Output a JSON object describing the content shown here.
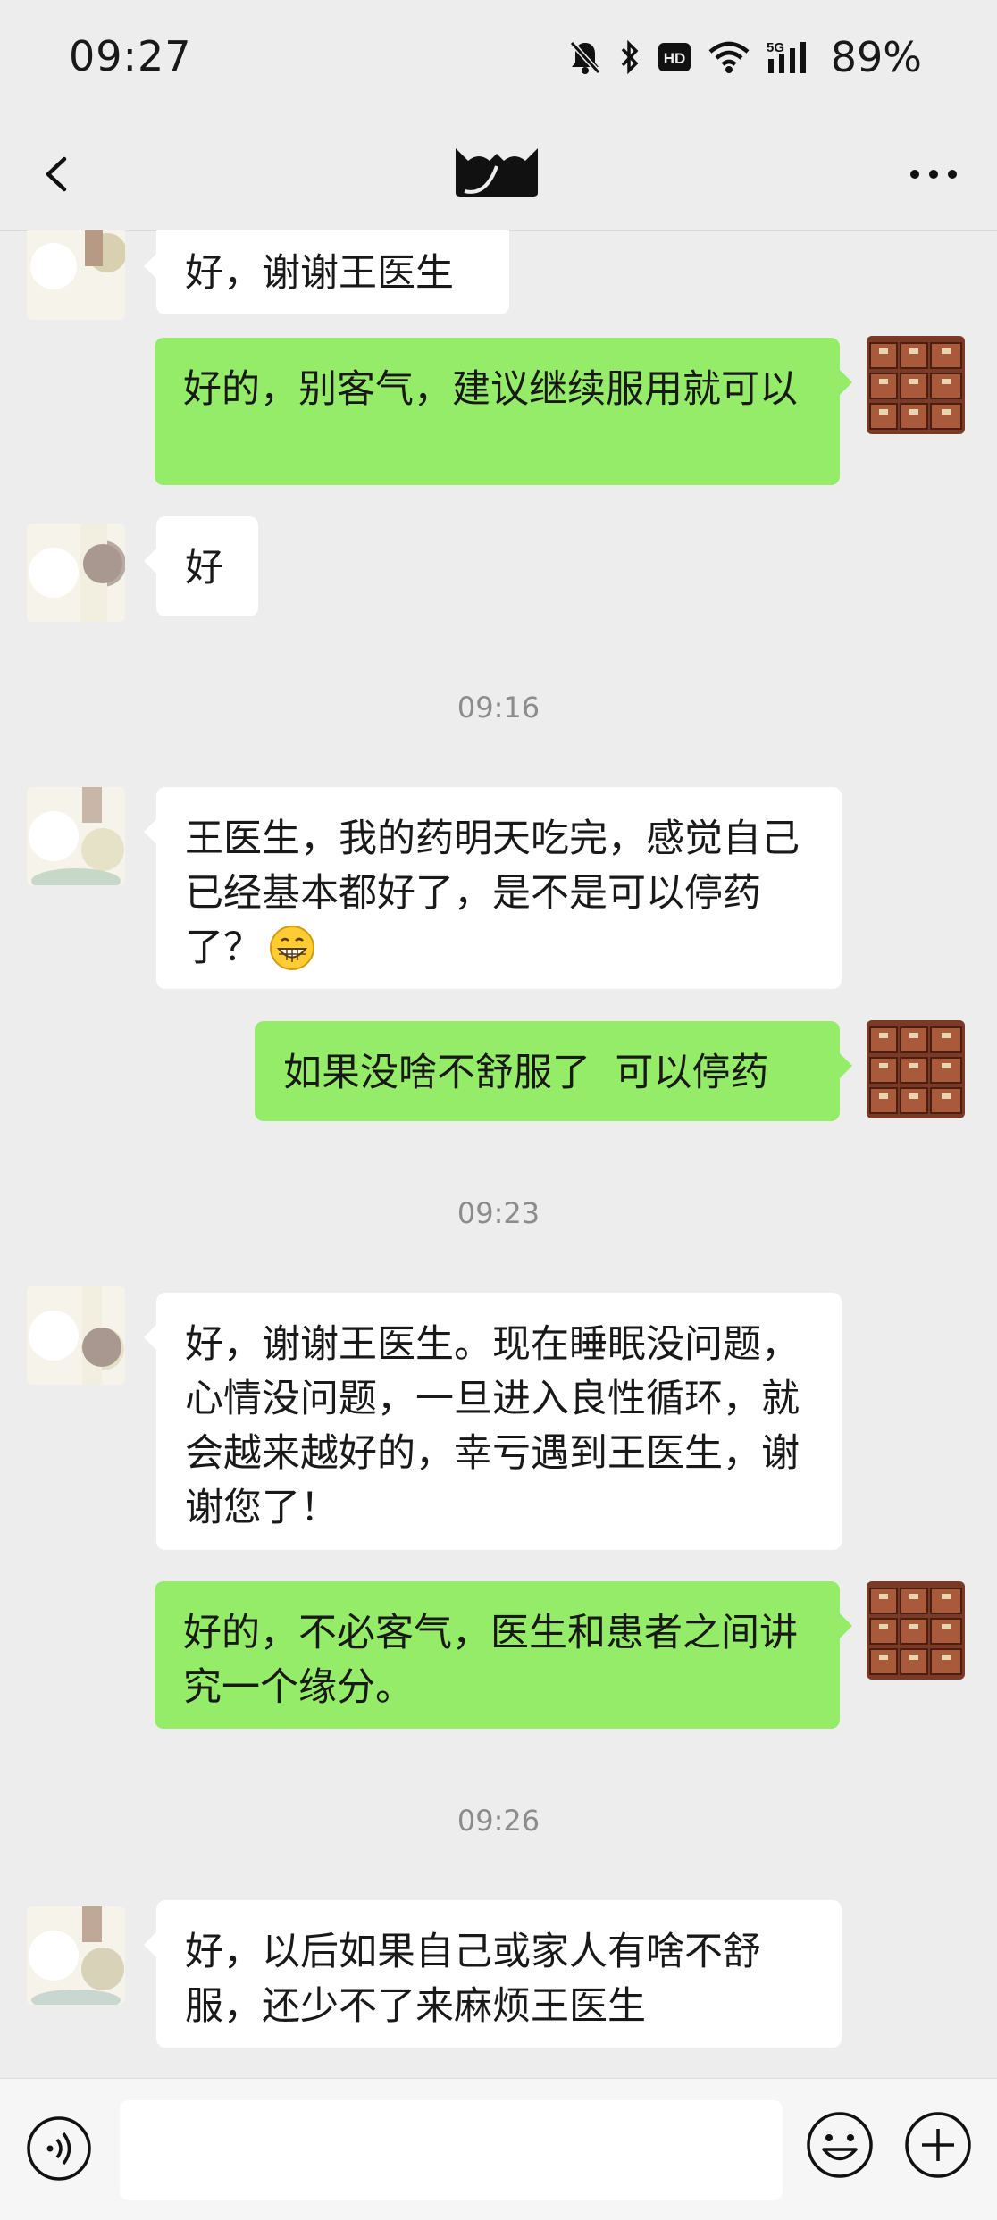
{
  "status_bar": {
    "time": "09:27",
    "icons": [
      "mute-bell-icon",
      "bluetooth-icon",
      "hd-icon",
      "wifi-icon",
      "5g-signal-icon"
    ],
    "battery": "89%"
  },
  "header": {
    "back_icon": "chevron-left-icon",
    "title_icon": "contact-logo-icon",
    "more_icon": "more-dots-icon"
  },
  "colors": {
    "background": "#ededed",
    "incoming_bubble": "#ffffff",
    "outgoing_bubble": "#95ec69",
    "timestamp_text": "#8c8c8c"
  },
  "messages": [
    {
      "side": "left",
      "text": "好，谢谢王医生"
    },
    {
      "side": "right",
      "text": "好的，别客气，建议继续服用就可以"
    },
    {
      "side": "left",
      "text": "好"
    },
    {
      "timestamp": "09:16"
    },
    {
      "side": "left",
      "text": "王医生，我的药明天吃完，感觉自己已经基本都好了，是不是可以停药了？",
      "emoji": "grinning-face-emoji"
    },
    {
      "side": "right",
      "text": "如果没啥不舒服了  可以停药"
    },
    {
      "timestamp": "09:23"
    },
    {
      "side": "left",
      "text": "好，谢谢王医生。现在睡眠没问题，心情没问题，一旦进入良性循环，就会越来越好的，幸亏遇到王医生，谢谢您了！"
    },
    {
      "side": "right",
      "text": "好的，不必客气，医生和患者之间讲究一个缘分。"
    },
    {
      "timestamp": "09:26"
    },
    {
      "side": "left",
      "text": "好，以后如果自己或家人有啥不舒服，还少不了来麻烦王医生"
    }
  ],
  "input_bar": {
    "voice_icon": "voice-input-icon",
    "emoji_icon": "emoji-icon",
    "plus_icon": "plus-icon",
    "input_value": ""
  }
}
